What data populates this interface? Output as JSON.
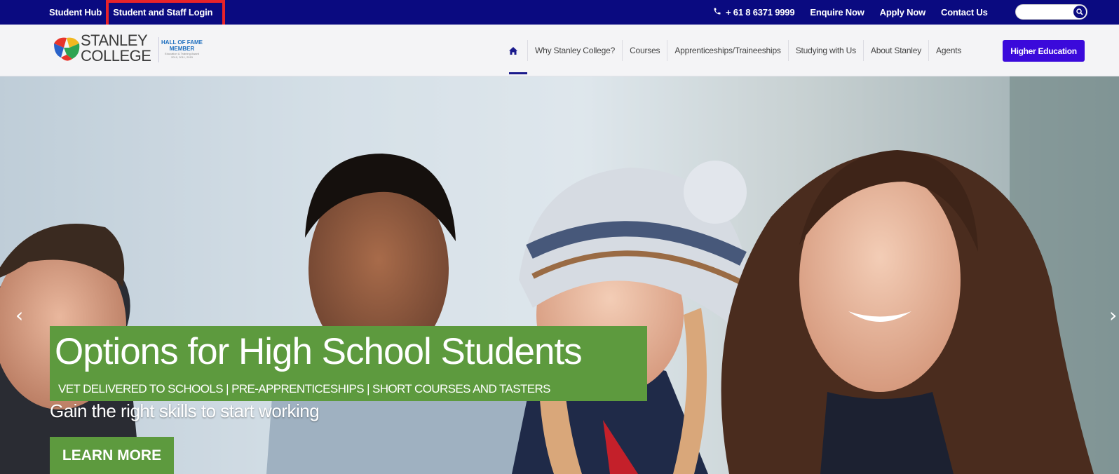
{
  "topbar": {
    "student_hub": "Student Hub",
    "separator": "|",
    "student_staff_login": "Student and Staff Login",
    "phone": "+ 61 8 6371 9999",
    "enquire_now": "Enquire Now",
    "apply_now": "Apply Now",
    "contact_us": "Contact Us",
    "search_placeholder": "",
    "highlight_color": "#e8232a",
    "bar_color": "#0a0a80"
  },
  "logo": {
    "line1": "STANLEY",
    "line2": "COLLEGE",
    "hall_of_fame": "HALL OF FAME",
    "member": "MEMBER",
    "fine_print": "Education & Training Award",
    "years": "2010, 2011, 2015"
  },
  "nav": {
    "items": [
      "Why Stanley College?",
      "Courses",
      "Apprenticeships/Traineeships",
      "Studying with Us",
      "About Stanley",
      "Agents"
    ],
    "higher_education": "Higher Education",
    "higher_education_color": "#3b0adb"
  },
  "hero": {
    "headline": "Options for High School Students",
    "subheadline": "VET DELIVERED TO SCHOOLS | PRE-APPRENTICESHIPS | SHORT COURSES AND TASTERS",
    "tagline": "Gain the right skills to start working",
    "cta": "LEARN MORE",
    "prev_arrow": "‹",
    "next_arrow": "›",
    "accent_color": "#5d9a3e"
  }
}
